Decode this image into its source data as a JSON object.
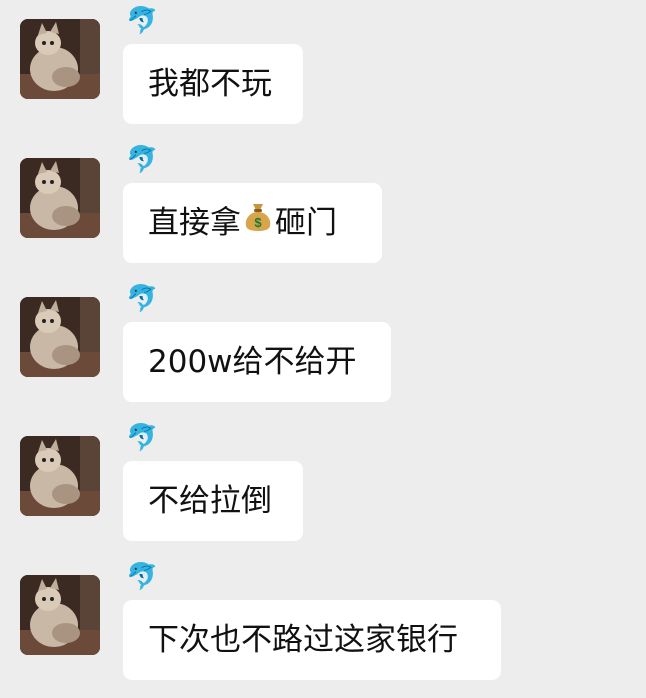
{
  "chat": {
    "messages": [
      {
        "sender_icon": "dolphin-icon",
        "nickname": "🐬",
        "text": "我都不玩"
      },
      {
        "sender_icon": "dolphin-icon",
        "nickname": "🐬",
        "text_before": "直接拿",
        "inline_emoji": "money-bag-icon",
        "text_after": "砸门"
      },
      {
        "sender_icon": "dolphin-icon",
        "nickname": "🐬",
        "text": "200w给不给开"
      },
      {
        "sender_icon": "dolphin-icon",
        "nickname": "🐬",
        "text": "不给拉倒"
      },
      {
        "sender_icon": "dolphin-icon",
        "nickname": "🐬",
        "text": "下次也不路过这家银行"
      }
    ]
  }
}
